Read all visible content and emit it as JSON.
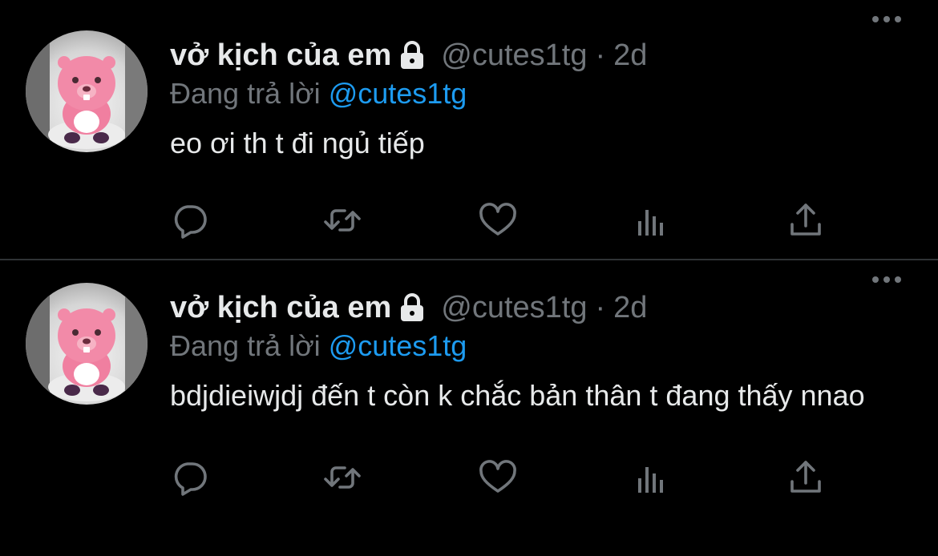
{
  "tweets": [
    {
      "author": {
        "name": "vở kịch của em",
        "handle": "@cutes1tg",
        "protected_icon": "lock-icon",
        "avatar_icon": "pink-beaver-avatar"
      },
      "separator": "·",
      "timestamp": "2d",
      "reply_prefix": "Đang trả lời",
      "reply_to": "@cutes1tg",
      "text": "eo ơi th t đi ngủ tiếp",
      "actions": [
        "reply-icon",
        "retweet-icon",
        "like-icon",
        "views-icon",
        "share-icon"
      ]
    },
    {
      "author": {
        "name": "vở kịch của em",
        "handle": "@cutes1tg",
        "protected_icon": "lock-icon",
        "avatar_icon": "pink-beaver-avatar"
      },
      "separator": "·",
      "timestamp": "2d",
      "reply_prefix": "Đang trả lời",
      "reply_to": "@cutes1tg",
      "text": "bdjdieiwjdj đến t còn k chắc bản thân t đang thấy nnao",
      "actions": [
        "reply-icon",
        "retweet-icon",
        "like-icon",
        "views-icon",
        "share-icon"
      ]
    }
  ],
  "colors": {
    "background": "#000000",
    "primary_text": "#e7e9ea",
    "secondary_text": "#71767b",
    "link": "#1d9bf0",
    "divider": "#2f3336"
  }
}
